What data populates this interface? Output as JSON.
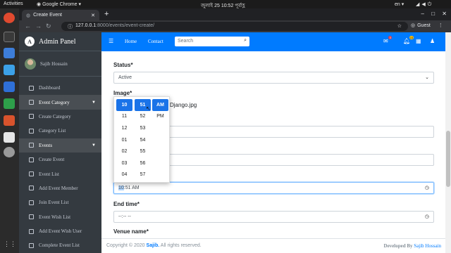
{
  "system": {
    "activities": "Activities",
    "app_name": "Google Chrome",
    "clock": "জুলাই 25  10:52 পূর্বাহ্ণ",
    "lang": "en"
  },
  "browser": {
    "tab_title": "Create Event",
    "new_tab": "+",
    "url_host": "127.0.0.1",
    "url_path": ":8000/events/event-create/",
    "guest": "Guest"
  },
  "sidebar": {
    "brand": "Admin Panel",
    "brand_logo": "A",
    "user": "Sajib Hossain",
    "items": [
      {
        "label": "Dashboard"
      },
      {
        "label": "Event Category"
      },
      {
        "label": "Create Category"
      },
      {
        "label": "Category List"
      },
      {
        "label": "Events"
      },
      {
        "label": "Create Event"
      },
      {
        "label": "Event List"
      },
      {
        "label": "Add Event Member"
      },
      {
        "label": "Join Event List"
      },
      {
        "label": "Event Wish List"
      },
      {
        "label": "Add Event Wish User"
      },
      {
        "label": "Complete Event List"
      }
    ]
  },
  "navbar": {
    "home": "Home",
    "contact": "Contact",
    "search_placeholder": "Search",
    "badge_messages": "3",
    "badge_notifications": "15"
  },
  "form": {
    "status_label": "Status*",
    "status_value": "Active",
    "image_label": "Image*",
    "image_filename": "Django.jpg",
    "start_time_hour": "10",
    "start_time_rest": ":51 AM",
    "end_time_label": "End time*",
    "end_time_value": "--:-- --",
    "venue_label": "Venue name*"
  },
  "time_picker": {
    "hours": [
      "10",
      "11",
      "12",
      "01",
      "02",
      "03",
      "04"
    ],
    "minutes": [
      "51",
      "52",
      "53",
      "54",
      "55",
      "56",
      "57"
    ],
    "periods": [
      "AM",
      "PM"
    ],
    "selected_hour": "10",
    "selected_minute": "51",
    "selected_period": "AM"
  },
  "footer": {
    "copyright_prefix": "Copyright © 2020 ",
    "brand": "Sajib.",
    "rights": " All rights reserved.",
    "developed_by": "Developed By ",
    "developer": "Sajib Hossain"
  },
  "colors": {
    "navbar": "#007bff",
    "sidebar": "#343a40",
    "picker_selected": "#1a73e8"
  }
}
